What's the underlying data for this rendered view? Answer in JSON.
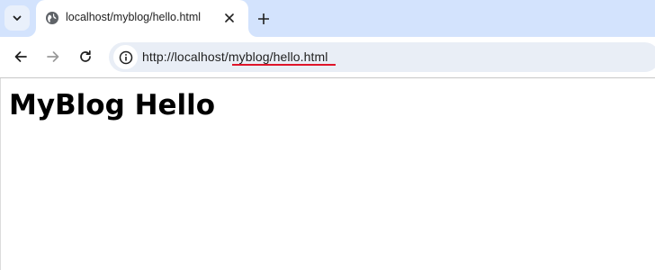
{
  "browser": {
    "tab": {
      "title": "localhost/myblog/hello.html",
      "favicon": "globe-icon"
    },
    "tab_search_icon": "chevron-down-icon",
    "close_icon": "close-icon",
    "new_tab_icon": "plus-icon",
    "toolbar": {
      "back_icon": "arrow-left-icon",
      "forward_icon": "arrow-right-icon",
      "reload_icon": "reload-icon",
      "site_info_icon": "info-icon",
      "url": "http://localhost/myblog/hello.html",
      "highlighted_url_part": "myblog/hello.html",
      "highlight_color": "#e0142a"
    }
  },
  "page": {
    "heading": "MyBlog Hello"
  },
  "colors": {
    "tabstrip_bg": "#d3e3fd",
    "omnibox_bg": "#e9eef6"
  }
}
